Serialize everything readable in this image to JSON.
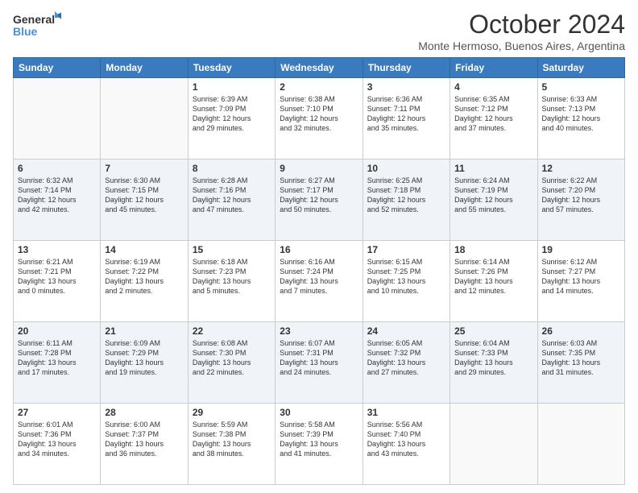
{
  "logo": {
    "line1": "General",
    "line2": "Blue"
  },
  "title": "October 2024",
  "subtitle": "Monte Hermoso, Buenos Aires, Argentina",
  "days_of_week": [
    "Sunday",
    "Monday",
    "Tuesday",
    "Wednesday",
    "Thursday",
    "Friday",
    "Saturday"
  ],
  "weeks": [
    [
      {
        "day": "",
        "info": ""
      },
      {
        "day": "",
        "info": ""
      },
      {
        "day": "1",
        "info": "Sunrise: 6:39 AM\nSunset: 7:09 PM\nDaylight: 12 hours\nand 29 minutes."
      },
      {
        "day": "2",
        "info": "Sunrise: 6:38 AM\nSunset: 7:10 PM\nDaylight: 12 hours\nand 32 minutes."
      },
      {
        "day": "3",
        "info": "Sunrise: 6:36 AM\nSunset: 7:11 PM\nDaylight: 12 hours\nand 35 minutes."
      },
      {
        "day": "4",
        "info": "Sunrise: 6:35 AM\nSunset: 7:12 PM\nDaylight: 12 hours\nand 37 minutes."
      },
      {
        "day": "5",
        "info": "Sunrise: 6:33 AM\nSunset: 7:13 PM\nDaylight: 12 hours\nand 40 minutes."
      }
    ],
    [
      {
        "day": "6",
        "info": "Sunrise: 6:32 AM\nSunset: 7:14 PM\nDaylight: 12 hours\nand 42 minutes."
      },
      {
        "day": "7",
        "info": "Sunrise: 6:30 AM\nSunset: 7:15 PM\nDaylight: 12 hours\nand 45 minutes."
      },
      {
        "day": "8",
        "info": "Sunrise: 6:28 AM\nSunset: 7:16 PM\nDaylight: 12 hours\nand 47 minutes."
      },
      {
        "day": "9",
        "info": "Sunrise: 6:27 AM\nSunset: 7:17 PM\nDaylight: 12 hours\nand 50 minutes."
      },
      {
        "day": "10",
        "info": "Sunrise: 6:25 AM\nSunset: 7:18 PM\nDaylight: 12 hours\nand 52 minutes."
      },
      {
        "day": "11",
        "info": "Sunrise: 6:24 AM\nSunset: 7:19 PM\nDaylight: 12 hours\nand 55 minutes."
      },
      {
        "day": "12",
        "info": "Sunrise: 6:22 AM\nSunset: 7:20 PM\nDaylight: 12 hours\nand 57 minutes."
      }
    ],
    [
      {
        "day": "13",
        "info": "Sunrise: 6:21 AM\nSunset: 7:21 PM\nDaylight: 13 hours\nand 0 minutes."
      },
      {
        "day": "14",
        "info": "Sunrise: 6:19 AM\nSunset: 7:22 PM\nDaylight: 13 hours\nand 2 minutes."
      },
      {
        "day": "15",
        "info": "Sunrise: 6:18 AM\nSunset: 7:23 PM\nDaylight: 13 hours\nand 5 minutes."
      },
      {
        "day": "16",
        "info": "Sunrise: 6:16 AM\nSunset: 7:24 PM\nDaylight: 13 hours\nand 7 minutes."
      },
      {
        "day": "17",
        "info": "Sunrise: 6:15 AM\nSunset: 7:25 PM\nDaylight: 13 hours\nand 10 minutes."
      },
      {
        "day": "18",
        "info": "Sunrise: 6:14 AM\nSunset: 7:26 PM\nDaylight: 13 hours\nand 12 minutes."
      },
      {
        "day": "19",
        "info": "Sunrise: 6:12 AM\nSunset: 7:27 PM\nDaylight: 13 hours\nand 14 minutes."
      }
    ],
    [
      {
        "day": "20",
        "info": "Sunrise: 6:11 AM\nSunset: 7:28 PM\nDaylight: 13 hours\nand 17 minutes."
      },
      {
        "day": "21",
        "info": "Sunrise: 6:09 AM\nSunset: 7:29 PM\nDaylight: 13 hours\nand 19 minutes."
      },
      {
        "day": "22",
        "info": "Sunrise: 6:08 AM\nSunset: 7:30 PM\nDaylight: 13 hours\nand 22 minutes."
      },
      {
        "day": "23",
        "info": "Sunrise: 6:07 AM\nSunset: 7:31 PM\nDaylight: 13 hours\nand 24 minutes."
      },
      {
        "day": "24",
        "info": "Sunrise: 6:05 AM\nSunset: 7:32 PM\nDaylight: 13 hours\nand 27 minutes."
      },
      {
        "day": "25",
        "info": "Sunrise: 6:04 AM\nSunset: 7:33 PM\nDaylight: 13 hours\nand 29 minutes."
      },
      {
        "day": "26",
        "info": "Sunrise: 6:03 AM\nSunset: 7:35 PM\nDaylight: 13 hours\nand 31 minutes."
      }
    ],
    [
      {
        "day": "27",
        "info": "Sunrise: 6:01 AM\nSunset: 7:36 PM\nDaylight: 13 hours\nand 34 minutes."
      },
      {
        "day": "28",
        "info": "Sunrise: 6:00 AM\nSunset: 7:37 PM\nDaylight: 13 hours\nand 36 minutes."
      },
      {
        "day": "29",
        "info": "Sunrise: 5:59 AM\nSunset: 7:38 PM\nDaylight: 13 hours\nand 38 minutes."
      },
      {
        "day": "30",
        "info": "Sunrise: 5:58 AM\nSunset: 7:39 PM\nDaylight: 13 hours\nand 41 minutes."
      },
      {
        "day": "31",
        "info": "Sunrise: 5:56 AM\nSunset: 7:40 PM\nDaylight: 13 hours\nand 43 minutes."
      },
      {
        "day": "",
        "info": ""
      },
      {
        "day": "",
        "info": ""
      }
    ]
  ]
}
